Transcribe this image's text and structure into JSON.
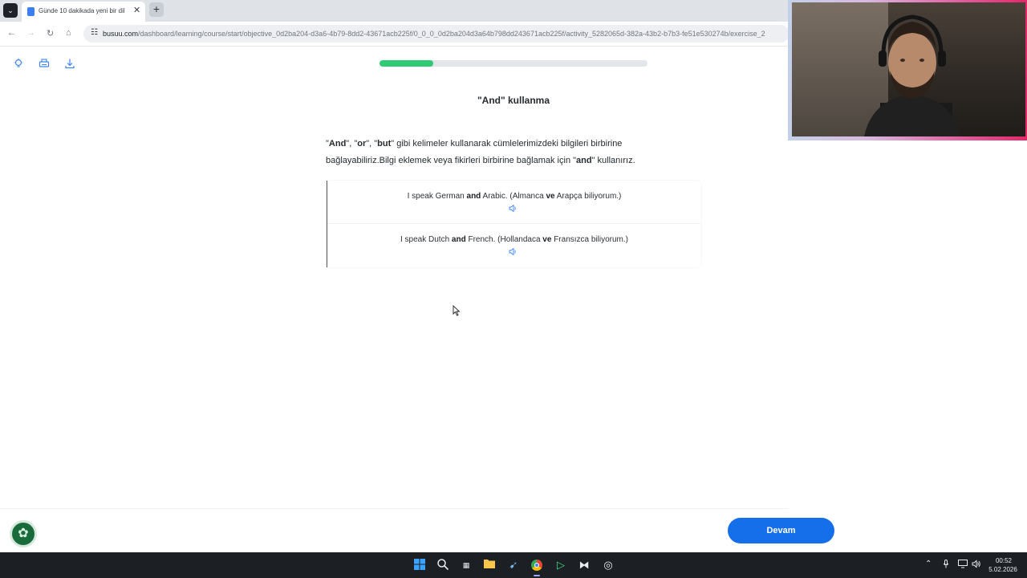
{
  "browser": {
    "tab_title": "Günde 10 dakikada yeni bir dil",
    "tab_close": "✕",
    "new_tab": "+",
    "url_domain": "busuu.com",
    "url_path": "/dashboard/learning/course/start/objective_0d2ba204-d3a6-4b79-8dd2-43671acb225f/0_0_0_0d2ba204d3a64b798dd243671acb225f/activity_5282065d-382a-43b2-b7b3-fe51e530274b/exercise_2"
  },
  "progress": {
    "fraction": 0.2
  },
  "lesson": {
    "title": "\"And\" kullanma",
    "explanation_parts": {
      "q1": "\"",
      "and": "And",
      "sep1": "\", \"",
      "or": "or",
      "sep2": "\", \"",
      "but": "but",
      "mid": "\" gibi kelimeler kullanarak cümlelerimizdeki bilgileri birbirine bağlayabiliriz.Bilgi eklemek veya fikirleri birbirine bağlamak için \"",
      "and2": "and",
      "end": "\" kullanırız."
    },
    "examples": [
      {
        "pre": "I speak German ",
        "bold": "and",
        "mid": " Arabic. (Almanca ",
        "bold2": "ve",
        "post": " Arapça biliyorum.)"
      },
      {
        "pre": "I speak Dutch ",
        "bold": "and",
        "mid": " French. (Hollandaca ",
        "bold2": "ve",
        "post": " Fransızca biliyorum.)"
      }
    ]
  },
  "footer": {
    "continue_label": "Devam"
  },
  "taskbar": {
    "time": "00:52",
    "date": "5.02.2026"
  },
  "icons": {
    "hint": "lightbulb-icon",
    "print": "print-icon",
    "download": "download-icon",
    "speaker": "speaker-icon",
    "cookie": "cookie-icon"
  },
  "colors": {
    "accent": "#166fea",
    "progress": "#2ecb74",
    "icon_blue": "#3f86f0"
  }
}
